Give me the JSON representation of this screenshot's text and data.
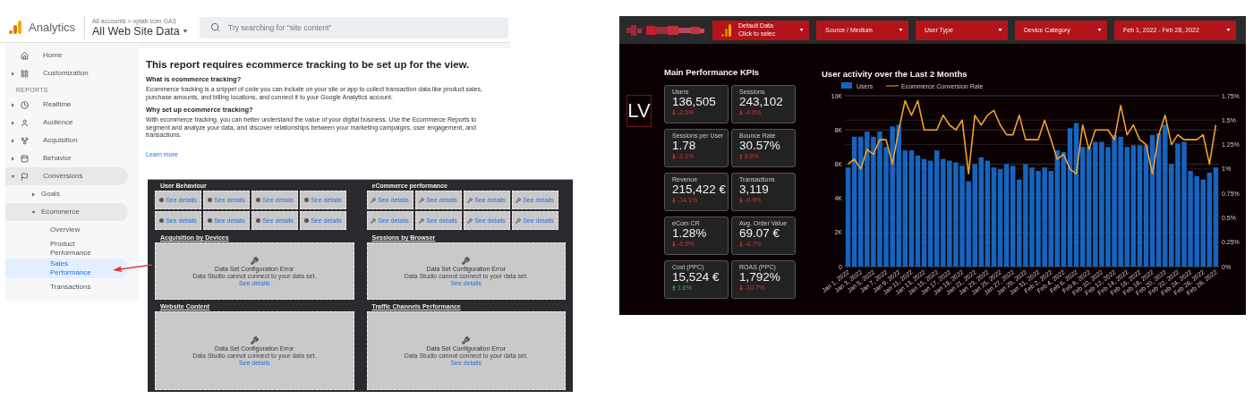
{
  "analytics": {
    "app_name": "Analytics",
    "breadcrumb": "All accounts > vplab.com GA3",
    "view": "All Web Site Data",
    "search": {
      "placeholder": "Try searching for \"site content\""
    },
    "sidebar": {
      "items": [
        {
          "label": "Home",
          "selected": false
        },
        {
          "label": "Customization",
          "expanded": false,
          "selected": false
        },
        {
          "kind": "heading",
          "label": "REPORTS"
        },
        {
          "label": "Realtime",
          "expanded": false,
          "selected": false
        },
        {
          "label": "Audience",
          "expanded": false,
          "selected": false
        },
        {
          "label": "Acquisition",
          "expanded": false,
          "selected": false
        },
        {
          "label": "Behavior",
          "expanded": false,
          "selected": false
        },
        {
          "label": "Conversions",
          "expanded": true,
          "selected": false,
          "children": [
            {
              "label": "Goals",
              "expanded": false,
              "selected": false
            },
            {
              "label": "Ecommerce",
              "expanded": true,
              "selected": false,
              "children": [
                {
                  "label": "Overview",
                  "selected": false
                },
                {
                  "label": "Product Performance",
                  "selected": false
                },
                {
                  "label": "Sales Performance",
                  "selected": true
                },
                {
                  "label": "Transactions",
                  "selected": false
                }
              ]
            }
          ]
        }
      ]
    },
    "report": {
      "heading": "This report requires ecommerce tracking to be set up for the view.",
      "sections": [
        {
          "title": "What is ecommerce tracking?",
          "body": "Ecommerce tracking is a snippet of code you can include on your site or app to collect transaction data like product sales, purchase amounts, and billing locations, and connect it to your Google Analytics account."
        },
        {
          "title": "Why set up ecommerce tracking?",
          "body": "With ecommerce tracking, you can better understand the value of your digital business. Use the Ecommerce Reports to segment and analyze your data, and discover relationships between your marketing campaigns, user engagement, and transactions."
        }
      ],
      "link": "Learn more"
    }
  },
  "report_preview": {
    "tile_groups": [
      {
        "title": "User Behaviour",
        "tiles": [
          "See details",
          "See details",
          "See details",
          "See details",
          "See details",
          "See details",
          "See details",
          "See details"
        ]
      },
      {
        "title": "eCommerce performance",
        "tiles": [
          "See details",
          "See details",
          "See details",
          "See details",
          "See details",
          "See details",
          "See details",
          "See details"
        ]
      }
    ],
    "panels": [
      {
        "title": "Acquisition by Devices",
        "error": "Data Set Configuration Error",
        "message": "Data Studio cannot connect to your data set.",
        "link": "See details"
      },
      {
        "title": "Sessions by Browser",
        "error": "Data Set Configuration Error",
        "message": "Data Studio cannot connect to your data set.",
        "link": "See details"
      },
      {
        "title": "Website Content",
        "error": "Data Set Configuration Error",
        "message": "Data Studio cannot connect to your data set.",
        "link": "See details"
      },
      {
        "title": "Traffic Channels Performance",
        "error": "Data Set Configuration Error",
        "message": "Data Studio cannot connect to your data set.",
        "link": "See details"
      }
    ]
  },
  "dashboard": {
    "filters": [
      {
        "kind": "data_source",
        "line1": "Default Data",
        "line2": "Click to selec"
      },
      {
        "kind": "select",
        "label": "Source / Medium"
      },
      {
        "kind": "select",
        "label": "User Type"
      },
      {
        "kind": "select",
        "label": "Device Category"
      },
      {
        "kind": "select",
        "label": "Feb 1, 2022 - Feb 28, 2022"
      }
    ],
    "badge": "LV",
    "kpi_title": "Main Performance KPIs",
    "kpis": [
      {
        "label": "Users",
        "value": "136,505",
        "change": "-2.6%",
        "rising": false,
        "good": false
      },
      {
        "label": "Sessions",
        "value": "243,102",
        "change": "-4.6%",
        "rising": false,
        "good": false
      },
      {
        "label": "Sessions per User",
        "value": "1.78",
        "change": "-2.1%",
        "rising": false,
        "good": false
      },
      {
        "label": "Bounce Rate",
        "value": "30.57%",
        "change": "8.9%",
        "rising": true,
        "good": false
      },
      {
        "label": "Revenue",
        "value": "215,422 €",
        "change": "-14.1%",
        "rising": false,
        "good": false
      },
      {
        "label": "Transactions",
        "value": "3,119",
        "change": "-9.9%",
        "rising": false,
        "good": false
      },
      {
        "label": "eCom CR",
        "value": "1.28%",
        "change": "-5.5%",
        "rising": false,
        "good": false
      },
      {
        "label": "Avg. Order Value",
        "value": "69.07 €",
        "change": "-4.7%",
        "rising": false,
        "good": false
      },
      {
        "label": "Cost (PPC)",
        "value": "15,524 €",
        "change": "1.6%",
        "rising": true,
        "good": true
      },
      {
        "label": "ROAS (PPC)",
        "value": "1,792%",
        "change": "-10.7%",
        "rising": false,
        "good": false
      }
    ],
    "chart_title": "User activity over the Last 2 Months",
    "chart_data": {
      "type": "bar",
      "grid": true,
      "legend": "top-left",
      "categories": [
        "Jan 1, 2022",
        null,
        "Jan 3, 2022",
        null,
        "Jan 5, 2022",
        null,
        "Jan 7, 2022",
        null,
        "Jan 9, 2022",
        null,
        "Jan 11, 2022",
        null,
        "Jan 13, 2022",
        null,
        "Jan 15, 2022",
        null,
        "Jan 17, 2022",
        null,
        "Jan 19, 2022",
        null,
        "Jan 21, 2022",
        null,
        "Jan 23, 2022",
        null,
        "Jan 25, 2022",
        null,
        "Jan 27, 2022",
        null,
        "Jan 29, 2022",
        null,
        "Jan 31, 2022",
        null,
        "Feb 2, 2022",
        null,
        "Feb 4, 2022",
        null,
        "Feb 6, 2022",
        null,
        "Feb 8, 2022",
        null,
        "Feb 10, 2022",
        null,
        "Feb 12, 2022",
        null,
        "Feb 14, 2022",
        null,
        "Feb 16, 2022",
        null,
        "Feb 18, 2022",
        null,
        "Feb 20, 2022",
        null,
        "Feb 22, 2022",
        null,
        "Feb 24, 2022",
        null,
        "Feb 26, 2022",
        null,
        "Feb 28, 2022"
      ],
      "series": [
        {
          "name": "Users",
          "color": "#1565c0",
          "values": [
            5800,
            7600,
            7600,
            7900,
            7600,
            7900,
            7000,
            8200,
            8300,
            6800,
            6800,
            6500,
            6300,
            6200,
            6800,
            6300,
            6200,
            6100,
            5900,
            5000,
            6000,
            6400,
            6200,
            5800,
            5700,
            6000,
            5900,
            5100,
            6000,
            5800,
            5600,
            5800,
            5600,
            6800,
            6700,
            8100,
            8400,
            7000,
            7000,
            7300,
            7300,
            7000,
            7700,
            7600,
            7000,
            7100,
            7100,
            7100,
            7700,
            7800,
            8300,
            6000,
            7200,
            7300,
            5600,
            5300,
            5100,
            5500,
            5800
          ]
        },
        {
          "name": "Ecommerce Conversion Rate",
          "type": "line",
          "axis": "y2",
          "color": "#f0a030",
          "values": [
            1.05,
            1.1,
            1.0,
            1.2,
            1.15,
            1.3,
            1.3,
            1.05,
            1.4,
            1.7,
            1.55,
            1.7,
            1.4,
            1.4,
            1.4,
            1.55,
            1.45,
            1.4,
            1.5,
            0.95,
            1.55,
            1.45,
            1.55,
            1.6,
            1.45,
            1.35,
            1.35,
            1.55,
            1.3,
            1.3,
            1.3,
            1.5,
            1.3,
            1.1,
            1.15,
            1.0,
            0.95,
            1.45,
            1.2,
            1.4,
            1.4,
            1.4,
            1.3,
            1.65,
            1.35,
            1.45,
            1.3,
            1.25,
            0.95,
            1.35,
            1.55,
            1.25,
            1.35,
            1.3,
            1.3,
            1.3,
            1.35,
            1.05,
            1.45
          ]
        }
      ],
      "ylim": [
        0,
        10000
      ],
      "yticks": [
        {
          "value": 0,
          "label": "0"
        },
        {
          "value": 2000,
          "label": "2K"
        },
        {
          "value": 4000,
          "label": "4K"
        },
        {
          "value": 6000,
          "label": "6K"
        },
        {
          "value": 8000,
          "label": "8K"
        },
        {
          "value": 10000,
          "label": "10K"
        }
      ],
      "y2lim": [
        0,
        1.75
      ],
      "y2ticks": [
        {
          "value": 0,
          "label": "0%"
        },
        {
          "value": 0.25,
          "label": "0.25%"
        },
        {
          "value": 0.5,
          "label": "0.5%"
        },
        {
          "value": 0.75,
          "label": "0.75%"
        },
        {
          "value": 1,
          "label": "1%"
        },
        {
          "value": 1.25,
          "label": "1.25%"
        },
        {
          "value": 1.5,
          "label": "1.5%"
        },
        {
          "value": 1.75,
          "label": "1.75%"
        }
      ]
    }
  }
}
